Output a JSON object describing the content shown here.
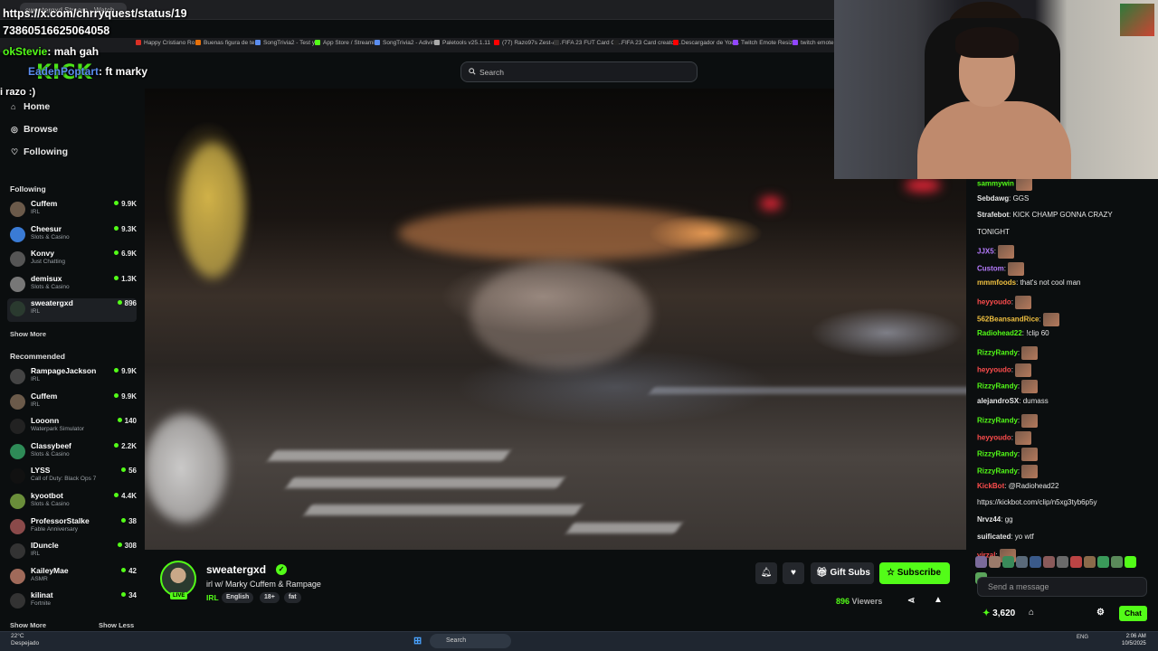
{
  "browser": {
    "tab_title": "sweatergxd Stream - Watch",
    "bookmarks": [
      {
        "label": "Happy Cristiano Ro...",
        "color": "#d93025"
      },
      {
        "label": "Buenas figura de te...",
        "color": "#e8710a"
      },
      {
        "label": "SongTrivia2 - Test y...",
        "color": "#5b8def"
      },
      {
        "label": "App Store / Streami...",
        "color": "#53fc18"
      },
      {
        "label": "SongTrivia2 - Adivin...",
        "color": "#5b8def"
      },
      {
        "label": "Paletools v25.1.11",
        "color": "#aaaaaa"
      },
      {
        "label": "(77) Razo97s Zest-A...",
        "color": "#ff0000"
      },
      {
        "label": "FIFA 23 FUT Card Cr...",
        "color": "#333333"
      },
      {
        "label": "FIFA 23 Card creator...",
        "color": "#222222"
      },
      {
        "label": "Descargador de You...",
        "color": "#ff0000"
      },
      {
        "label": "Twitch Emote Resizer",
        "color": "#9146ff"
      },
      {
        "label": "twitch emote resiz",
        "color": "#9146ff"
      }
    ]
  },
  "overlay": {
    "url_line1": "https://x.com/chrryquest/status/19",
    "url_line2": "73860516625064058",
    "line3_user": "okStevie",
    "line3_text": ": mah gah",
    "line4_user": "EadenPoptart",
    "line4_text": ": ft marky",
    "line5": "i razo :)"
  },
  "header": {
    "logo": "KICK",
    "search_placeholder": "Search"
  },
  "sidebar": {
    "nav": [
      {
        "label": "Home",
        "icon": "home-icon"
      },
      {
        "label": "Browse",
        "icon": "compass-icon"
      },
      {
        "label": "Following",
        "icon": "heart-icon"
      }
    ],
    "following_title": "Following",
    "following": [
      {
        "name": "Cuffem",
        "category": "IRL",
        "viewers": "9.9K",
        "color": "#6b5a4a"
      },
      {
        "name": "Cheesur",
        "category": "Slots & Casino",
        "viewers": "9.3K",
        "color": "#3a7bd5"
      },
      {
        "name": "Konvy",
        "category": "Just Chatting",
        "viewers": "6.9K",
        "color": "#555555"
      },
      {
        "name": "demisux",
        "category": "Slots & Casino",
        "viewers": "1.3K",
        "color": "#777777"
      },
      {
        "name": "sweatergxd",
        "category": "IRL",
        "viewers": "896",
        "color": "#2a3a2f"
      }
    ],
    "show_more_following": "Show More",
    "recommended_title": "Recommended",
    "recommended": [
      {
        "name": "RampageJackson",
        "category": "IRL",
        "viewers": "9.9K",
        "color": "#444444"
      },
      {
        "name": "Cuffem",
        "category": "IRL",
        "viewers": "9.9K",
        "color": "#6b5a4a"
      },
      {
        "name": "Looonn",
        "category": "Waterpark Simulator",
        "viewers": "140",
        "color": "#222222"
      },
      {
        "name": "Classybeef",
        "category": "Slots & Casino",
        "viewers": "2.2K",
        "color": "#2e8b57"
      },
      {
        "name": "LYSS",
        "category": "Call of Duty: Black Ops 7",
        "viewers": "56",
        "color": "#111111"
      },
      {
        "name": "kyootbot",
        "category": "Slots & Casino",
        "viewers": "4.4K",
        "color": "#6a8e3a"
      },
      {
        "name": "ProfessorStalke",
        "category": "Fable Anniversary",
        "viewers": "38",
        "color": "#8a4a4a"
      },
      {
        "name": "IDuncle",
        "category": "IRL",
        "viewers": "308",
        "color": "#333333"
      },
      {
        "name": "KaileyMae",
        "category": "ASMR",
        "viewers": "42",
        "color": "#a06a5a"
      },
      {
        "name": "kilinat",
        "category": "Fortnite",
        "viewers": "34",
        "color": "#333333"
      }
    ],
    "show_more_recommended": "Show More",
    "show_less": "Show Less"
  },
  "stream": {
    "streamer": "sweatergxd",
    "title": "irl w/ Marky Cuffem & Rampage",
    "category": "IRL",
    "tags": [
      "English",
      "18+",
      "fat"
    ],
    "live_label": "LIVE",
    "gift_label": "Gift Subs",
    "subscribe_label": "Subscribe",
    "viewers": "896",
    "viewers_label": "Viewers"
  },
  "chat": {
    "messages": [
      {
        "user": "sammywin",
        "text": "",
        "color": "#53fc18",
        "emote": true
      },
      {
        "user": "Sebdawg",
        "text": ": GGS",
        "color": "#e6e6e6",
        "emote": false
      },
      {
        "user": "Strafebot",
        "text": ": KICK CHAMP GONNA CRAZY",
        "color": "#e6e6e6",
        "emote": false
      },
      {
        "user": "",
        "text": "TONIGHT",
        "color": "#e6e6e6",
        "emote": false
      },
      {
        "user": "JJX5",
        "text": ":",
        "color": "#b77cff",
        "emote": true
      },
      {
        "user": "Custom",
        "text": ":",
        "color": "#b77cff",
        "emote": true
      },
      {
        "user": "mmmfoods",
        "text": ": that's not cool man",
        "color": "#f0c040",
        "emote": false
      },
      {
        "user": "heyyoudo",
        "text": ":",
        "color": "#ff4d4d",
        "emote": true
      },
      {
        "user": "562BeansandRice",
        "text": ":",
        "color": "#f0c040",
        "emote": true
      },
      {
        "user": "Radiohead22",
        "text": ": !clip 60",
        "color": "#53fc18",
        "emote": false
      },
      {
        "user": "RizzyRandy",
        "text": ":",
        "color": "#53fc18",
        "emote": true
      },
      {
        "user": "heyyoudo",
        "text": ":",
        "color": "#ff4d4d",
        "emote": true
      },
      {
        "user": "RizzyRandy",
        "text": ":",
        "color": "#53fc18",
        "emote": true
      },
      {
        "user": "alejandroSX",
        "text": ": dumass",
        "color": "#e6e6e6",
        "emote": false
      },
      {
        "user": "RizzyRandy",
        "text": ":",
        "color": "#53fc18",
        "emote": true
      },
      {
        "user": "heyyoudo",
        "text": ":",
        "color": "#ff4d4d",
        "emote": true
      },
      {
        "user": "RizzyRandy",
        "text": ":",
        "color": "#53fc18",
        "emote": true
      },
      {
        "user": "RizzyRandy",
        "text": ":",
        "color": "#53fc18",
        "emote": true
      },
      {
        "user": "KickBot",
        "text": ": @Radiohead22",
        "color": "#ff4d4d",
        "emote": false
      },
      {
        "user": "",
        "text": "https://kickbot.com/clip/n5xg3tyb6p5y",
        "color": "#e6e6e6",
        "emote": false
      },
      {
        "user": "Nrvz44",
        "text": ": gg",
        "color": "#e6e6e6",
        "emote": false
      },
      {
        "user": "suificated",
        "text": ": yo wtf",
        "color": "#e6e6e6",
        "emote": false
      },
      {
        "user": "virzal",
        "text": ":",
        "color": "#ff4d4d",
        "emote": true
      }
    ],
    "input_placeholder": "Send a message",
    "points": "3,620",
    "send_label": "Chat"
  },
  "taskbar": {
    "weather_temp": "22°C",
    "weather_desc": "Despejado",
    "search_label": "Search",
    "lang": "ENG",
    "time": "2:06 AM",
    "date": "10/5/2025"
  }
}
